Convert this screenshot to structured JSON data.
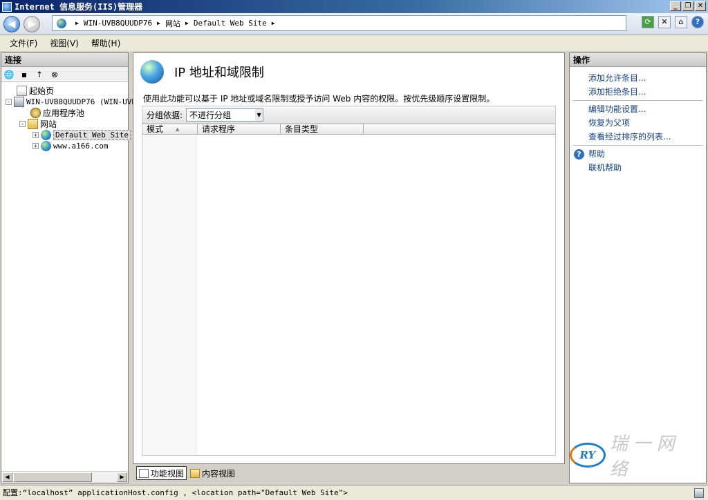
{
  "window": {
    "title": "Internet 信息服务(IIS)管理器"
  },
  "address": {
    "crumbs": [
      "WIN-UVB8QUUDP76",
      "网站",
      "Default Web Site"
    ],
    "separator": "▶"
  },
  "menu": {
    "file": "文件(F)",
    "view": "视图(V)",
    "help": "帮助(H)"
  },
  "connections": {
    "title": "连接",
    "tree": {
      "start_page": "起始页",
      "server": "WIN-UVB8QUUDP76 (WIN-UVB",
      "app_pools": "应用程序池",
      "sites": "网站",
      "default_site": "Default Web Site",
      "other_site": "www.a166.com"
    }
  },
  "feature": {
    "title": "IP 地址和域限制",
    "description": "使用此功能可以基于 IP 地址或域名限制或授予访问 Web 内容的权限。按优先级顺序设置限制。",
    "group_label": "分组依据:",
    "group_value": "不进行分组",
    "columns": [
      "模式",
      "请求程序",
      "条目类型"
    ]
  },
  "bottom_tabs": {
    "features_view": "功能视图",
    "content_view": "内容视图"
  },
  "actions": {
    "title": "操作",
    "add_allow": "添加允许条目...",
    "add_deny": "添加拒绝条目...",
    "edit_settings": "编辑功能设置...",
    "revert_parent": "恢复为父项",
    "view_ordered": "查看经过排序的列表...",
    "help": "帮助",
    "online_help": "联机帮助"
  },
  "watermark": {
    "logo": "RY",
    "text": "瑞一网络"
  },
  "status": {
    "text": "配置:“localhost” applicationHost.config , <location path=\"Default Web Site\">"
  },
  "colors": {
    "link": "#15428b",
    "title_bar": "#0a246a"
  }
}
